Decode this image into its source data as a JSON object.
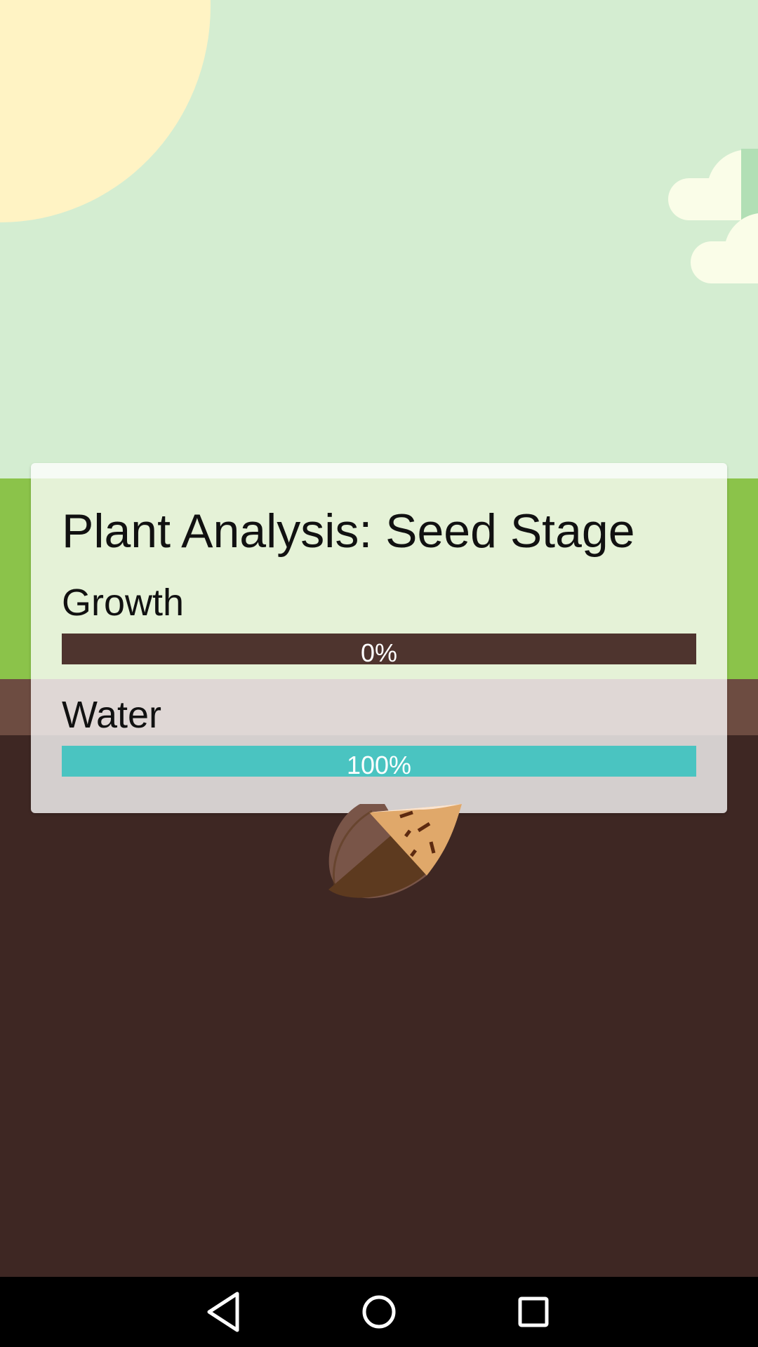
{
  "card": {
    "title": "Plant Analysis: Seed Stage",
    "growth": {
      "label": "Growth",
      "value": 0,
      "value_text": "0%",
      "fill_color": "#4e342e"
    },
    "water": {
      "label": "Water",
      "value": 100,
      "value_text": "100%",
      "fill_color": "#4ac4c1"
    }
  },
  "navigation": {
    "back_icon": "back-triangle-icon",
    "home_icon": "home-circle-icon",
    "recents_icon": "recents-square-icon"
  },
  "colors": {
    "sky": "#d4edd1",
    "grass": "#8bc34a",
    "topsoil": "#6d4c41",
    "soil": "#3e2723",
    "sun": "#fff3c4",
    "water_accent": "#4ac4c1"
  }
}
